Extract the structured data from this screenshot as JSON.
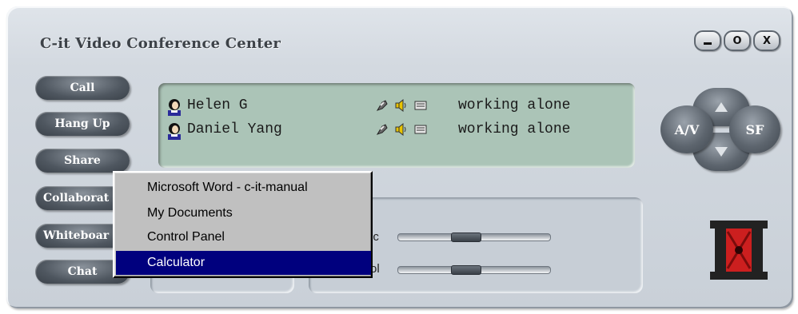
{
  "window": {
    "title": "C-it Video Conference Center",
    "controls": {
      "minimize": "_",
      "maximize": "O",
      "close": "X"
    }
  },
  "sidebar": {
    "buttons": [
      {
        "label": "Call"
      },
      {
        "label": "Hang Up"
      },
      {
        "label": "Share"
      },
      {
        "label": "Collaborat"
      },
      {
        "label": "Whiteboar"
      },
      {
        "label": "Chat"
      }
    ]
  },
  "participants": [
    {
      "name": "Helen G",
      "status": "working alone"
    },
    {
      "name": "Daniel Yang",
      "status": "working alone"
    }
  ],
  "audio": {
    "mic_label": "ic",
    "vol_label": "ol"
  },
  "navigation": {
    "av_label": "A/V",
    "sf_label": "SF"
  },
  "context_menu": {
    "items": [
      {
        "label": "Microsoft Word - c-it-manual",
        "selected": false
      },
      {
        "label": "My Documents",
        "selected": false
      },
      {
        "label": "Control Panel",
        "selected": false
      },
      {
        "label": "Calculator",
        "selected": true
      }
    ]
  },
  "colors": {
    "list_bg": "#abc4b7",
    "menu_highlight": "#00007e",
    "button_dark": "#4f5760"
  }
}
